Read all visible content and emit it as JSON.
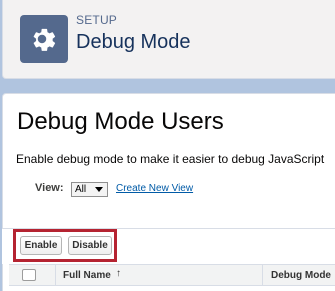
{
  "header": {
    "eyebrow": "SETUP",
    "title": "Debug Mode",
    "icon": "gear-icon"
  },
  "main": {
    "title": "Debug Mode Users",
    "description": "Enable debug mode to make it easier to debug JavaScript",
    "view_label": "View:",
    "view_selected": "All",
    "create_view_link": "Create New View"
  },
  "buttons": {
    "enable": "Enable",
    "disable": "Disable"
  },
  "table": {
    "columns": [
      "Full Name",
      "Debug Mode"
    ],
    "sort_indicator": "↑"
  },
  "colors": {
    "highlight": "#b52331",
    "link": "#015ba7",
    "icon_bg": "#54698d",
    "page_bg": "#b0c4df"
  }
}
